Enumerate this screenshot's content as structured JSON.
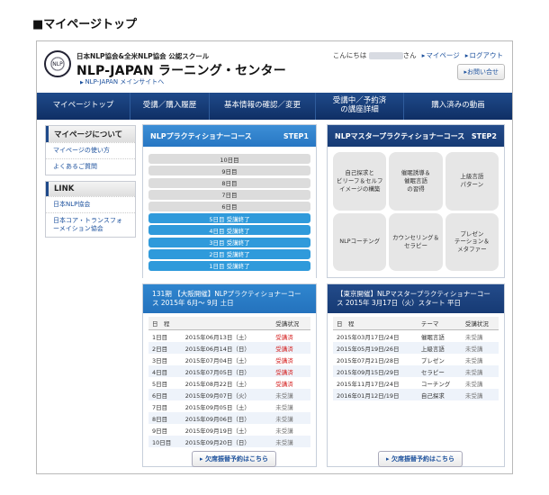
{
  "page_heading": "■マイページトップ",
  "header": {
    "org": "日本NLP協会&全米NLP協会 公認スクール",
    "brand": "NLP-JAPAN ラーニング・センター",
    "mainsite_link": "NLP-JAPAN メインサイトへ",
    "greeting_prefix": "こんにちは",
    "greeting_suffix": "さん",
    "mypage_link": "マイページ",
    "logout_link": "ログアウト",
    "contact_button": "お問い合せ",
    "logo_text": "NLP"
  },
  "nav": [
    {
      "label": "マイページトップ"
    },
    {
      "label": "受講／購入履歴"
    },
    {
      "label": "基本情報の確認／変更"
    },
    {
      "label": "受講中／予約済の講座詳細"
    },
    {
      "label": "購入済みの動画"
    }
  ],
  "sidebar": {
    "box1_title": "マイページについて",
    "box1_links": [
      "マイページの使い方",
      "よくあるご質問"
    ],
    "box2_title": "LINK",
    "box2_links": [
      "日本NLP協会",
      "日本コア・トランスフォーメイション協会"
    ]
  },
  "course1": {
    "title": "NLPプラクティショナーコース",
    "step": "STEP1",
    "pending": [
      "10日目",
      "9日目",
      "8日目",
      "7日目",
      "6日目"
    ],
    "done": [
      "5日目 受講終了",
      "4日目 受講終了",
      "3日目 受講終了",
      "2日目 受講終了",
      "1日目 受講終了"
    ]
  },
  "course2": {
    "title": "NLPマスタープラクティショナーコース",
    "step": "STEP2",
    "pieces": [
      "自己探求と\nビリーフ＆セルフ\nイメージの構築",
      "催眠誘導＆\n催眠言語\nの習得",
      "上級言語\nパターン",
      "NLPコーチング",
      "カウンセリング＆\nセラピー",
      "プレゼン\nテーション＆\nメタファー"
    ]
  },
  "schedule1": {
    "title": "131期 【大阪開催】NLPプラクティショナーコース 2015年 6月～ 9月 土日",
    "col_date": "日　程",
    "col_status": "受講状況",
    "rows": [
      {
        "day": "1日目",
        "date": "2015年06月13日（土）",
        "status": "受講済"
      },
      {
        "day": "2日目",
        "date": "2015年06月14日（日）",
        "status": "受講済"
      },
      {
        "day": "3日目",
        "date": "2015年07月04日（土）",
        "status": "受講済"
      },
      {
        "day": "4日目",
        "date": "2015年07月05日（日）",
        "status": "受講済"
      },
      {
        "day": "5日目",
        "date": "2015年08月22日（土）",
        "status": "受講済"
      },
      {
        "day": "6日目",
        "date": "2015年09月07日（火）",
        "status": "未受講"
      },
      {
        "day": "7日目",
        "date": "2015年09月05日（土）",
        "status": "未受講"
      },
      {
        "day": "8日目",
        "date": "2015年09月06日（日）",
        "status": "未受講"
      },
      {
        "day": "9日目",
        "date": "2015年09月19日（土）",
        "status": "未受講"
      },
      {
        "day": "10日目",
        "date": "2015年09月20日（日）",
        "status": "未受講"
      }
    ],
    "button": "欠席振替予約はこちら"
  },
  "schedule2": {
    "title": "【東京開催】NLPマスタープラクティショナーコース 2015年 3月17日（火）スタート 平日",
    "col_date": "日　程",
    "col_theme": "テーマ",
    "col_status": "受講状況",
    "rows": [
      {
        "date": "2015年03月17日/24日",
        "theme": "催眠言語",
        "status": "未受講"
      },
      {
        "date": "2015年05月19日/26日",
        "theme": "上級言語",
        "status": "未受講"
      },
      {
        "date": "2015年07月21日/28日",
        "theme": "プレゼン",
        "status": "未受講"
      },
      {
        "date": "2015年09月15日/29日",
        "theme": "セラピー",
        "status": "未受講"
      },
      {
        "date": "2015年11月17日/24日",
        "theme": "コーチング",
        "status": "未受講"
      },
      {
        "date": "2016年01月12日/19日",
        "theme": "自己探求",
        "status": "未受講"
      }
    ],
    "button": "欠席振替予約はこちら"
  },
  "colors": {
    "nav": "#1f4a8a",
    "accent": "#2f9adb",
    "done_status": "#d31b1b"
  }
}
